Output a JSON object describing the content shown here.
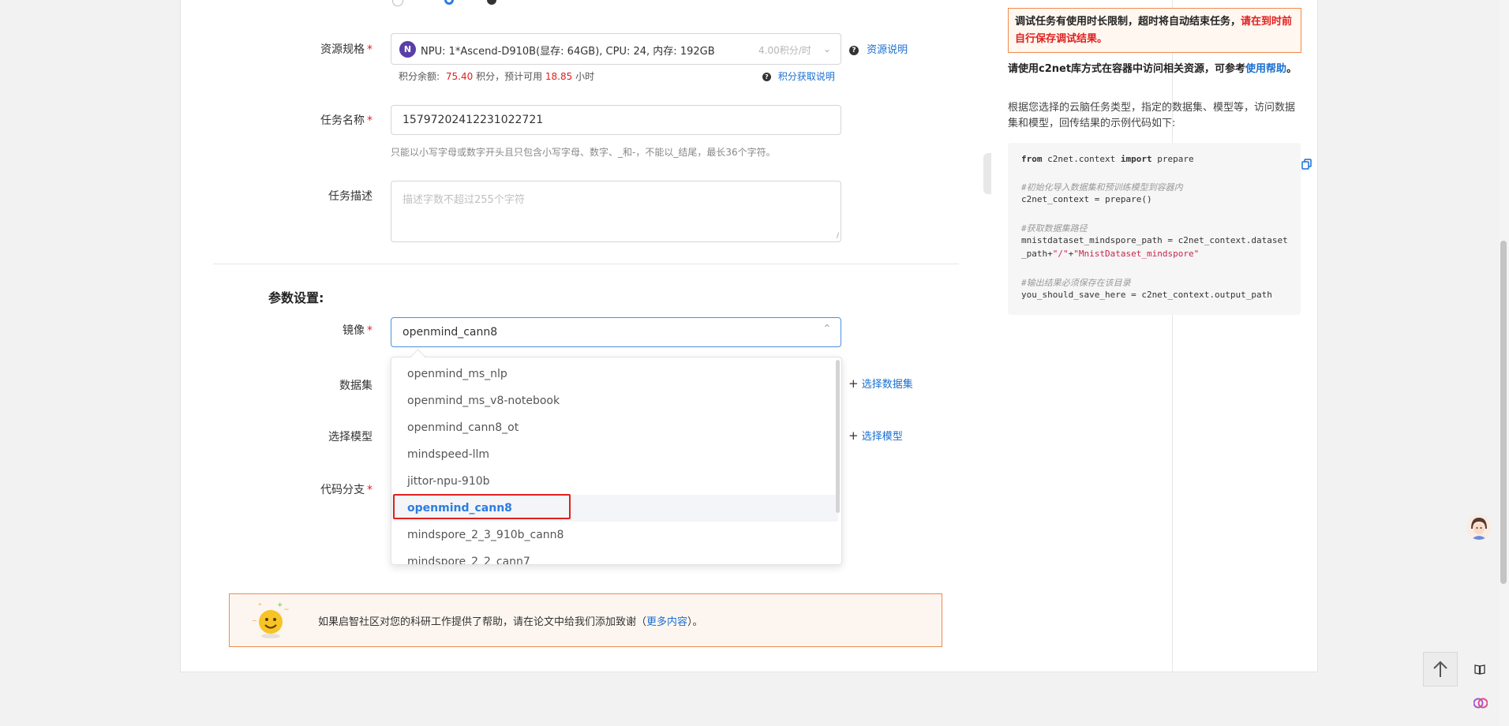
{
  "form": {
    "resource_spec": {
      "label": "资源规格",
      "badge": "N",
      "value": "NPU: 1*Ascend-D910B(显存: 64GB), CPU: 24, 内存: 192GB",
      "price": "4.00积分/时",
      "help_link": "资源说明",
      "points_label": "积分余额:",
      "points_value": "75.40",
      "points_mid": "积分，预计可用",
      "hours_value": "18.85",
      "hours_unit": "小时",
      "points_help_link": "积分获取说明"
    },
    "task_name": {
      "label": "任务名称",
      "value": "15797202412231022721",
      "hint": "只能以小写字母或数字开头且只包含小写字母、数字、_和-，不能以_结尾，最长36个字符。"
    },
    "task_desc": {
      "label": "任务描述",
      "placeholder": "描述字数不超过255个字符"
    },
    "params_title": "参数设置:",
    "image": {
      "label": "镜像",
      "value": "openmind_cann8"
    },
    "dataset": {
      "label": "数据集",
      "action": "选择数据集"
    },
    "model": {
      "label": "选择模型",
      "action": "选择模型"
    },
    "branch": {
      "label": "代码分支"
    }
  },
  "dropdown": {
    "options": [
      "openmind_ms_nlp",
      "openmind_ms_v8-notebook",
      "openmind_cann8_ot",
      "mindspeed-llm",
      "jittor-npu-910b",
      "openmind_cann8",
      "mindspore_2_3_910b_cann8",
      "mindspore_2_2_cann7"
    ],
    "selected_index": 5
  },
  "notice": {
    "text_before": "如果启智社区对您的科研工作提供了帮助，请在论文中给我们添加致谢（",
    "link": "更多内容",
    "text_after": "）。"
  },
  "sidebar": {
    "warning_bold": "调试任务有使用时长限制，超时将自动结束任务，",
    "warning_red": "请在到时前自行保存调试结果。",
    "c2net_text": "请使用c2net库方式在容器中访问相关资源，可参考",
    "c2net_link": "使用帮助",
    "c2net_period": "。",
    "desc": "根据您选择的云脑任务类型，指定的数据集、模型等，访问数据集和模型，回传结果的示例代码如下:",
    "code": {
      "line1_kw1": "from",
      "line1_mid": " c2net.context ",
      "line1_kw2": "import",
      "line1_end": " prepare",
      "comment1": "#初始化导入数据集和预训练模型到容器内",
      "line2": "c2net_context = prepare()",
      "comment2": "#获取数据集路径",
      "line3a": "mnistdataset_mindspore_path = c2net_context.dataset",
      "line3b": "_path+",
      "line3c": "\"/\"",
      "line3d": "+",
      "line3e": "\"MnistDataset_mindspore\"",
      "comment3": "#输出结果必须保存在该目录",
      "line4": "you_should_save_here = c2net_context.output_path"
    }
  },
  "colors": {
    "accent": "#1a6fd1",
    "warning_border": "#f08a4b",
    "required": "#e02020",
    "selected_text": "#2b7de0"
  }
}
